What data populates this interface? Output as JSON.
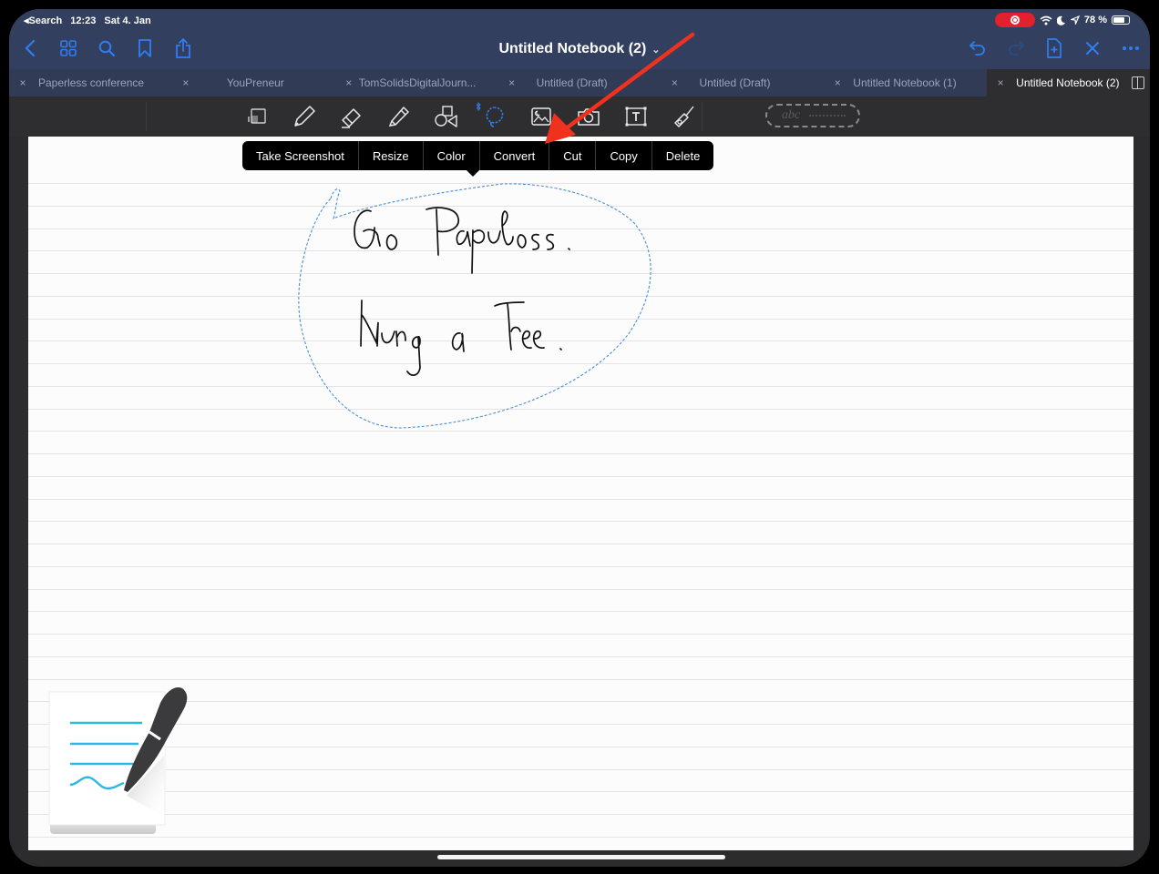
{
  "status_bar": {
    "back_app": "Search",
    "time": "12:23",
    "date": "Sat 4. Jan",
    "battery": "78 %",
    "battery_level": 0.78,
    "recording": true
  },
  "nav": {
    "title": "Untitled Notebook (2)",
    "title_chevron": "⌄",
    "left_icons": [
      "back-icon",
      "grid-icon",
      "search-icon",
      "bookmark-icon",
      "share-icon"
    ],
    "right_icons": [
      "undo-icon",
      "redo-icon",
      "add-page-icon",
      "close-icon",
      "more-icon"
    ]
  },
  "tabs": [
    {
      "label": "Paperless conference",
      "close": "×",
      "active": false
    },
    {
      "label": "YouPreneur",
      "close": "×",
      "active": false
    },
    {
      "label": "TomSolidsDigitalJourn...",
      "close": "×",
      "active": false
    },
    {
      "label": "Untitled (Draft)",
      "close": "×",
      "active": false
    },
    {
      "label": "Untitled (Draft)",
      "close": "×",
      "active": false
    },
    {
      "label": "Untitled Notebook (1)",
      "close": "×",
      "active": false
    },
    {
      "label": "Untitled Notebook (2)",
      "close": "×",
      "active": true
    }
  ],
  "toolbar": {
    "tools": [
      "zoom-window",
      "pen",
      "eraser",
      "highlighter",
      "shapes",
      "lasso",
      "image",
      "camera",
      "text",
      "laser-pointer"
    ],
    "selected_tool": "lasso",
    "text_tool_placeholder": "abc"
  },
  "context_menu": {
    "items": [
      "Take Screenshot",
      "Resize",
      "Color",
      "Convert",
      "Cut",
      "Copy",
      "Delete"
    ]
  },
  "canvas": {
    "handwriting_lines": [
      "Go Paperless.",
      "Hug a Tree."
    ],
    "selection_color": "#4a8fd6"
  },
  "annotation": {
    "arrow_color": "#f0311e",
    "points_to": "Convert"
  },
  "colors": {
    "nav_bg": "#323f5f",
    "accent": "#2f7ef0",
    "toolbar_bg": "#2e2e30",
    "rec": "#e3202e"
  }
}
